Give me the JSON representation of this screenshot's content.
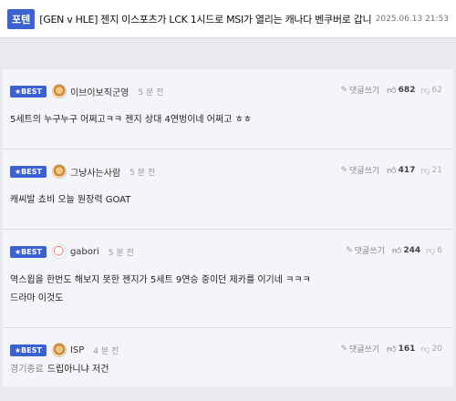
{
  "post": {
    "tag": "포텐",
    "title": "[GEN v HLE] 젠지 이스포츠가 LCK 1시드로 MSI가 열리는 캐나다 벤쿠버로 갑니다!!!!!!!!",
    "date": "2025.06.13 21:53"
  },
  "comments": [
    {
      "badge": "★BEST",
      "nick": "이브이보직군영",
      "time": "5 분 전",
      "reply_label": "댓글쓰기",
      "likes": "682",
      "dislikes": "62",
      "body": "5세트의 누구누구 어쩌고ㅋㅋ 젠지 상대 4연벙이네 어쩌고 ㅎㅎ"
    },
    {
      "badge": "★BEST",
      "nick": "그냥사는사람",
      "time": "5 분 전",
      "reply_label": "댓글쓰기",
      "likes": "417",
      "dislikes": "21",
      "body": "캐씨발 쵸비 오늘 원장력 GOAT"
    },
    {
      "badge": "★BEST",
      "nick": "gabori",
      "time": "5 분 전",
      "reply_label": "댓글쓰기",
      "likes": "244",
      "dislikes": "6",
      "body": "역스윕을 한번도 해보지 못한 젠지가 5세트 9연승 중이던 제카를 이기네 ㅋㅋㅋ",
      "body2": "드라마 이것도"
    },
    {
      "badge": "★BEST",
      "nick": "ISP",
      "time": "4 분 전",
      "reply_label": "댓글쓰기",
      "likes": "161",
      "dislikes": "20",
      "prefix": "경기종료",
      "body": "드립아니냐 저건"
    }
  ],
  "icons": {
    "reply": "pencil-icon",
    "like": "thumbs-up-icon",
    "dislike": "thumbs-down-icon"
  },
  "colors": {
    "accent": "#3b62d1"
  }
}
